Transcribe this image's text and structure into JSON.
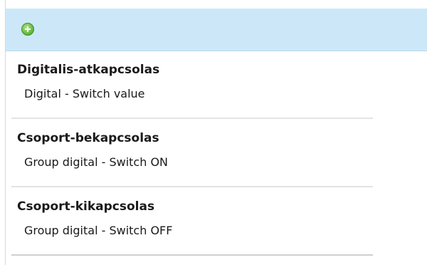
{
  "toolbar": {
    "add_icon": "plus-circle-icon",
    "accent_color": "#cce8f8",
    "add_color": "#6cc046"
  },
  "items": [
    {
      "title": "Digitalis-atkapcsolas",
      "subtitle": "Digital - Switch value"
    },
    {
      "title": "Csoport-bekapcsolas",
      "subtitle": "Group digital - Switch ON"
    },
    {
      "title": "Csoport-kikapcsolas",
      "subtitle": "Group digital - Switch OFF"
    }
  ]
}
